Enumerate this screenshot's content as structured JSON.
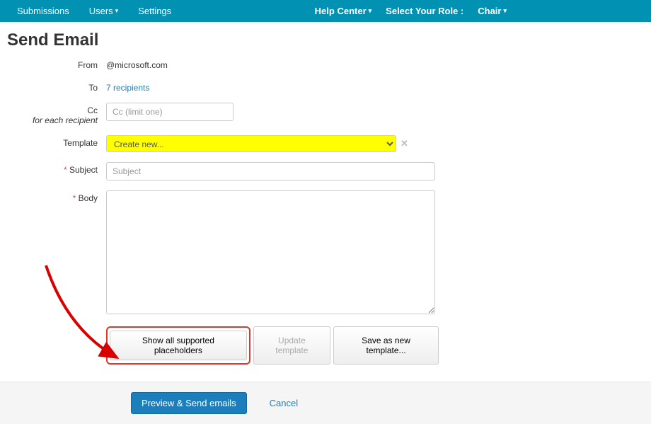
{
  "nav": {
    "submissions": "Submissions",
    "users": "Users",
    "settings": "Settings",
    "help": "Help Center",
    "role_label": "Select Your Role :",
    "role_value": "Chair"
  },
  "page_title": "Send Email",
  "labels": {
    "from": "From",
    "to": "To",
    "cc": "Cc",
    "cc_hint": "for each recipient",
    "template": "Template",
    "subject": "Subject",
    "body": "Body"
  },
  "values": {
    "from": "@microsoft.com",
    "to": "7 recipients",
    "template_selected": "Create new..."
  },
  "placeholders": {
    "cc": "Cc (limit one)",
    "subject": "Subject"
  },
  "buttons": {
    "show_placeholders": "Show all supported placeholders",
    "update_template": "Update template",
    "save_template": "Save as new template...",
    "preview_send": "Preview & Send emails",
    "cancel": "Cancel"
  }
}
